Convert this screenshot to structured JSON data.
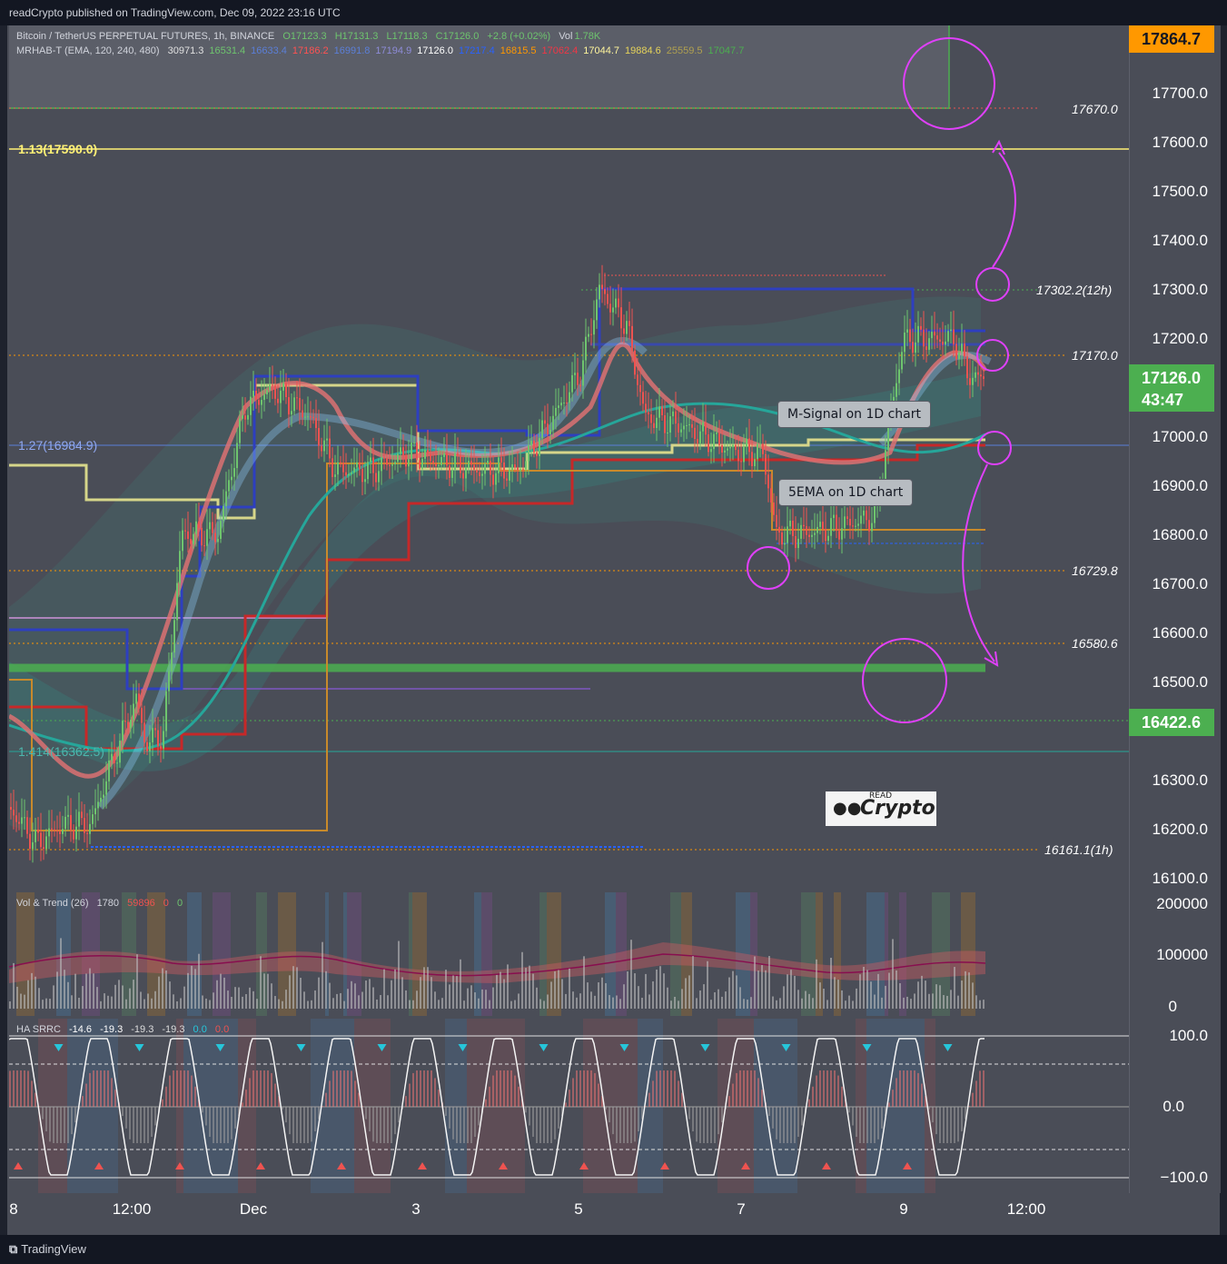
{
  "header": {
    "published": "readCrypto published on TradingView.com, Dec 09, 2022 23:16 UTC"
  },
  "legend_main": {
    "symbol": "Bitcoin / TetherUS PERPETUAL FUTURES, 1h, BINANCE",
    "ohlc": [
      "O17123.3",
      "H17131.3",
      "L17118.3",
      "C17126.0"
    ],
    "change": "+2.8 (+0.02%)",
    "vol_label": "Vol",
    "vol_value": "1.78K",
    "indicator": "MRHAB-T (EMA, 120, 240, 480)",
    "indicator_values": [
      "30971.3",
      "16531.4",
      "16633.4",
      "17186.2",
      "16991.8",
      "17194.9",
      "17126.0",
      "17217.4",
      "16815.5",
      "17062.4",
      "17044.7",
      "19884.6",
      "25559.5",
      "17047.7"
    ],
    "indicator_colors": [
      "#e0e0e0",
      "#6ec46e",
      "#5b7fd8",
      "#ff5252",
      "#5b7fd8",
      "#8e8cd8",
      "#ffffff",
      "#2962ff",
      "#ff9800",
      "#f23645",
      "#fff59d",
      "#e6d35a",
      "#b0a050",
      "#4caf50"
    ]
  },
  "legend_vol": {
    "name": "Vol & Trend (26)",
    "v1": "1780",
    "v2": "59896",
    "v3": "0",
    "v4": "0"
  },
  "legend_osc": {
    "name": "HA SRRC",
    "v1": "-14.6",
    "v2": "-19.3",
    "v3": "-19.3",
    "v4": "-19.3",
    "v5": "0.0",
    "v6": "0.0"
  },
  "price_axis": [
    "17700.0",
    "17600.0",
    "17500.0",
    "17400.0",
    "17300.0",
    "17200.0",
    "17000.0",
    "16900.0",
    "16800.0",
    "16700.0",
    "16600.0",
    "16500.0",
    "16400.0",
    "16300.0",
    "16200.0",
    "16100.0"
  ],
  "price_tags": {
    "top": "17864.7",
    "current": "17126.0",
    "countdown": "43:47",
    "support": "16422.6"
  },
  "vol_axis": [
    "200000",
    "100000",
    "0"
  ],
  "osc_axis": [
    "100.0",
    "0.0",
    "−100.0"
  ],
  "time_axis": [
    "8",
    "12:00",
    "Dec",
    "3",
    "5",
    "7",
    "9",
    "12:00"
  ],
  "lines": {
    "fib_113": "1.13(17590.0)",
    "fib_127": "1.27(16984.9)",
    "fib_1414": "1.414(16362.5)",
    "l17670": "17670.0",
    "l17302": "17302.2(12h)",
    "l17170": "17170.0",
    "l16729": "16729.8",
    "l16580": "16580.6",
    "l16161": "16161.1(1h)"
  },
  "callouts": {
    "msignal": "M-Signal on 1D chart",
    "ema5": "5EMA on 1D chart"
  },
  "logo": {
    "small": "READ",
    "big": "Crypto"
  },
  "footer": {
    "brand": "TradingView"
  },
  "colors": {
    "bg": "#4a4d57",
    "up": "#6ec46e",
    "down": "#ef5350",
    "magenta": "#e040fb",
    "orange": "#ff9800",
    "yellow": "#fff176"
  }
}
